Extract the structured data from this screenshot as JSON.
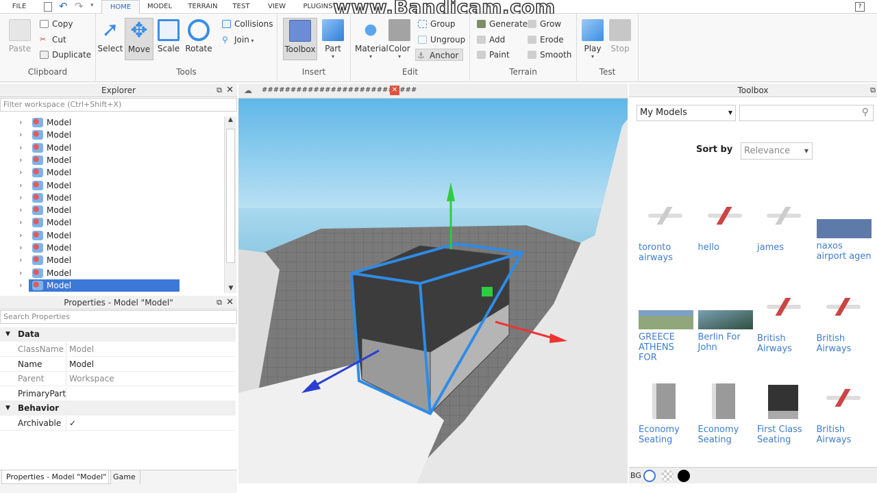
{
  "menu": {
    "tabs": [
      "FILE",
      "HOME",
      "MODEL",
      "TERRAIN",
      "TEST",
      "VIEW",
      "PLUGINS"
    ]
  },
  "watermark": "www.Bandicam.com",
  "ribbon": {
    "clipboard": {
      "title": "Clipboard",
      "paste": "Paste",
      "copy": "Copy",
      "cut": "Cut",
      "duplicate": "Duplicate"
    },
    "tools": {
      "title": "Tools",
      "select": "Select",
      "move": "Move",
      "scale": "Scale",
      "rotate": "Rotate",
      "collisions": "Collisions",
      "join": "Join"
    },
    "insert": {
      "title": "Insert",
      "toolbox": "Toolbox",
      "part": "Part"
    },
    "edit": {
      "title": "Edit",
      "material": "Material",
      "color": "Color",
      "group": "Group",
      "ungroup": "Ungroup",
      "anchor": "Anchor"
    },
    "terrain": {
      "title": "Terrain",
      "generate": "Generate",
      "add": "Add",
      "paint": "Paint",
      "grow": "Grow",
      "erode": "Erode",
      "smooth": "Smooth"
    },
    "test": {
      "title": "Test",
      "play": "Play",
      "stop": "Stop"
    }
  },
  "explorer": {
    "title": "Explorer",
    "filter_placeholder": "Filter workspace (Ctrl+Shift+X)",
    "items": [
      "Model",
      "Model",
      "Model",
      "Model",
      "Model",
      "Model",
      "Model",
      "Model",
      "Model",
      "Model",
      "Model",
      "Model",
      "Model",
      "Model"
    ]
  },
  "properties": {
    "title": "Properties - Model \"Model\"",
    "search_placeholder": "Search Properties",
    "sections": [
      {
        "name": "Data",
        "rows": [
          [
            "ClassName",
            "Model"
          ],
          [
            "Name",
            "Model"
          ],
          [
            "Parent",
            "Workspace"
          ],
          [
            "PrimaryPart",
            ""
          ]
        ]
      },
      {
        "name": "Behavior",
        "rows": [
          [
            "Archivable",
            "✓"
          ]
        ]
      }
    ]
  },
  "bottom_tabs": [
    "Properties - Model \"Model\"",
    "Game"
  ],
  "viewport": {
    "doc_tab": "###########################"
  },
  "toolbox": {
    "title": "Toolbox",
    "category": "My Models",
    "sort_label": "Sort by",
    "sort_value": "Relevance",
    "bg_label": "BG",
    "items": [
      {
        "label": "toronto airways"
      },
      {
        "label": "hello"
      },
      {
        "label": "james"
      },
      {
        "label": "naxos airport agen"
      },
      {
        "label": "GREECE ATHENS FOR"
      },
      {
        "label": "Berlin For John"
      },
      {
        "label": "British Airways"
      },
      {
        "label": "British Airways"
      },
      {
        "label": "Economy Seating"
      },
      {
        "label": "Economy Seating"
      },
      {
        "label": "First Class Seating"
      },
      {
        "label": "British Airways"
      }
    ]
  }
}
